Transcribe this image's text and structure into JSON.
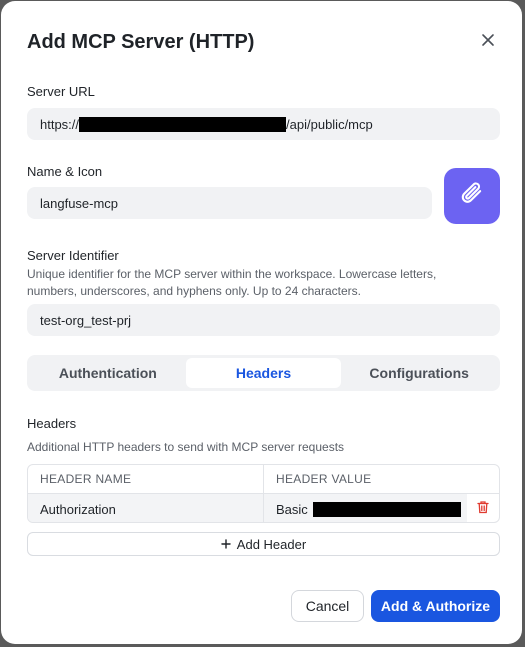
{
  "dialog": {
    "title": "Add MCP Server (HTTP)"
  },
  "server_url": {
    "label": "Server URL",
    "value_prefix": "https://",
    "value_suffix": "/api/public/mcp"
  },
  "name_icon": {
    "label": "Name & Icon",
    "value": "langfuse-mcp",
    "icon": "paperclip-icon",
    "icon_bg": "#6c63f2"
  },
  "server_identifier": {
    "label": "Server Identifier",
    "help": "Unique identifier for the MCP server within the workspace. Lowercase letters, numbers, underscores, and hyphens only. Up to 24 characters.",
    "value": "test-org_test-prj"
  },
  "tabs": [
    {
      "label": "Authentication",
      "active": false
    },
    {
      "label": "Headers",
      "active": true
    },
    {
      "label": "Configurations",
      "active": false
    }
  ],
  "headers_section": {
    "title": "Headers",
    "help": "Additional HTTP headers to send with MCP server requests",
    "columns": [
      "HEADER NAME",
      "HEADER VALUE"
    ],
    "rows": [
      {
        "name": "Authorization",
        "value_prefix": "Basic"
      }
    ],
    "add_label": "Add Header"
  },
  "footer": {
    "cancel_label": "Cancel",
    "primary_label": "Add & Authorize"
  },
  "colors": {
    "accent": "#1a56e0",
    "danger": "#e03a2f"
  }
}
